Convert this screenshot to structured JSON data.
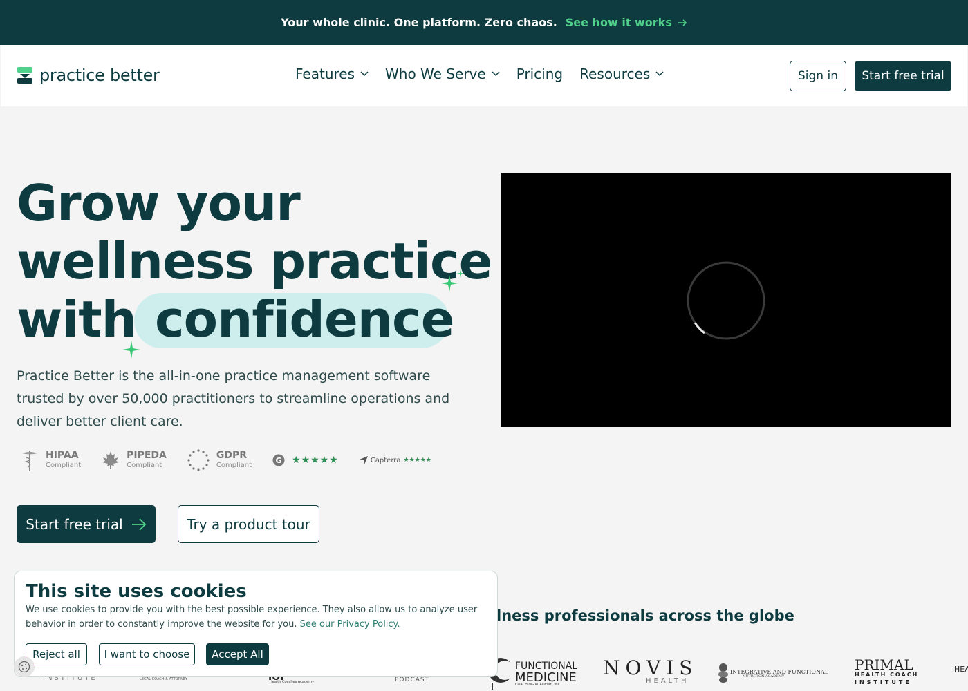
{
  "announcement": {
    "message": "Your whole clinic. One platform. Zero chaos.",
    "link": "See how it works"
  },
  "nav": {
    "logo": "practice better",
    "menu": [
      {
        "label": "Features",
        "has_dropdown": true
      },
      {
        "label": "Who We Serve",
        "has_dropdown": true
      },
      {
        "label": "Pricing",
        "has_dropdown": false
      },
      {
        "label": "Resources",
        "has_dropdown": true
      }
    ],
    "sign_in": "Sign in",
    "start_trial": "Start free trial"
  },
  "hero": {
    "title_line1": "Grow your",
    "title_line2": "wellness practice",
    "title_line3": "with",
    "title_highlight": "confidence",
    "description": "Practice Better is the all-in-one practice management software trusted by over 50,000 practitioners to streamline operations and deliver better client care.",
    "badges": [
      {
        "name": "HIPAA",
        "sub": "Compliant",
        "icon": "caduceus-icon"
      },
      {
        "name": "PIPEDA",
        "sub": "Compliant",
        "icon": "maple-leaf-icon"
      },
      {
        "name": "GDPR",
        "sub": "Compliant",
        "icon": "eu-stars-icon"
      }
    ],
    "g2_rating": "★★★★★",
    "capterra_label": "Capterra",
    "capterra_rating": "★★★★★",
    "cta_primary": "Start free trial",
    "cta_secondary": "Try a product tour"
  },
  "trusted": {
    "heading": "lness professionals across the globe",
    "logos": [
      {
        "text": "INSTITUTE"
      },
      {
        "text": "LEGAL COACH & ATTORNEY"
      },
      {
        "text": "IOI"
      },
      {
        "text": "Health Coaches Academy"
      },
      {
        "text": "PODCAST"
      },
      {
        "text": "FUNCTIONAL"
      },
      {
        "text": "MEDICINE"
      },
      {
        "text": "COACHING ACADEMY, INC."
      },
      {
        "text": "NOVIS"
      },
      {
        "text": "HEALTH"
      },
      {
        "text": "INTEGRATIVE AND FUNCTIONAL"
      },
      {
        "text": "NUTRITION ACADEMY"
      },
      {
        "text": "PRIMAL"
      },
      {
        "text": "HEALTH COACH"
      },
      {
        "text": "INSTITUTE"
      },
      {
        "text": "HEA"
      }
    ]
  },
  "cookie": {
    "title": "This site uses cookies",
    "text": "We use cookies to provide you with the best possible experience. They also allow us to analyze user behavior in order to constantly improve the website for you.",
    "link": "See our Privacy Policy.",
    "reject": "Reject all",
    "choose": "I want to choose",
    "accept": "Accept All"
  },
  "colors": {
    "brand_dark": "#0d3b3f",
    "brand_green": "#4fd18b",
    "highlight": "#cdeeed"
  }
}
